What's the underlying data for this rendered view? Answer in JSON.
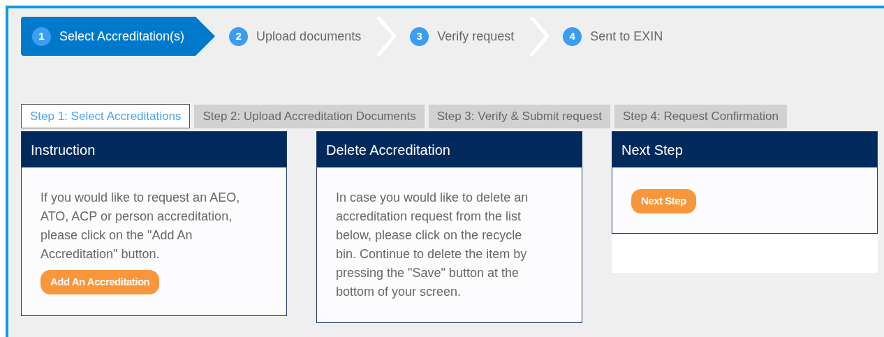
{
  "steps": [
    {
      "number": "1",
      "label": "Select Accreditation(s)",
      "selected": true
    },
    {
      "number": "2",
      "label": "Upload documents",
      "selected": false
    },
    {
      "number": "3",
      "label": "Verify request",
      "selected": false
    },
    {
      "number": "4",
      "label": "Sent to EXIN",
      "selected": false
    }
  ],
  "tabs": [
    {
      "label": "Step 1: Select Accreditations",
      "selected": true
    },
    {
      "label": "Step 2: Upload Accreditation Documents",
      "selected": false
    },
    {
      "label": "Step 3: Verify & Submit request",
      "selected": false
    },
    {
      "label": "Step 4: Request Confirmation",
      "selected": false
    }
  ],
  "panels": [
    {
      "title": "Instruction",
      "text": "If you would like to request an AEO, ATO, ACP or person accreditation, please click on the \"Add An Accreditation\" button.",
      "button": "Add An Accreditation"
    },
    {
      "title": "Delete Accreditation",
      "text": "In case you would like to delete an accreditation request from the list below, please click on the recycle bin. Continue to delete the item by pressing the \"Save\" button at the bottom of your screen."
    },
    {
      "title": "Next Step",
      "button": "Next Step"
    }
  ]
}
